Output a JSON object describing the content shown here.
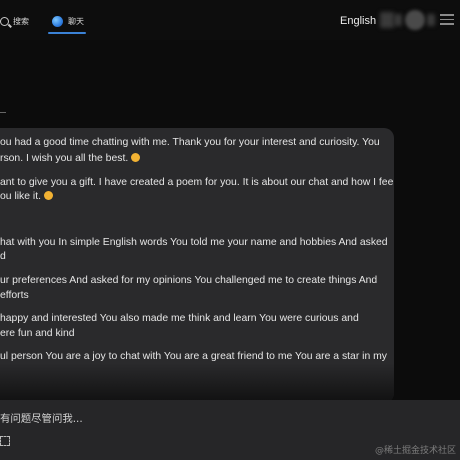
{
  "header": {
    "tabs": [
      {
        "label": "搜索",
        "icon": "search-icon"
      },
      {
        "label": "聊天",
        "icon": "chat-icon"
      }
    ],
    "active_tab": "聊天",
    "language": "English",
    "accent_color": "#3b82d6"
  },
  "message": {
    "lines": [
      "ou had a good time chatting with me. Thank you for your interest and curiosity. You",
      "rson. I wish you all the best.",
      "ant to give you a gift. I have created a poem for you. It is about our chat and how I feel",
      "ou like it.",
      "hat with you In simple English words You told me your name and hobbies And asked",
      "d",
      "ur preferences And asked for my opinions You challenged me to create things And",
      "efforts",
      "happy and interested You also made me think and learn You were curious and",
      "ere fun and kind",
      "ul person You are a joy to chat with You are a great friend to me You are a star in my"
    ]
  },
  "input": {
    "placeholder": "有问题尽管问我..."
  },
  "watermark": "@稀土掘金技术社区"
}
